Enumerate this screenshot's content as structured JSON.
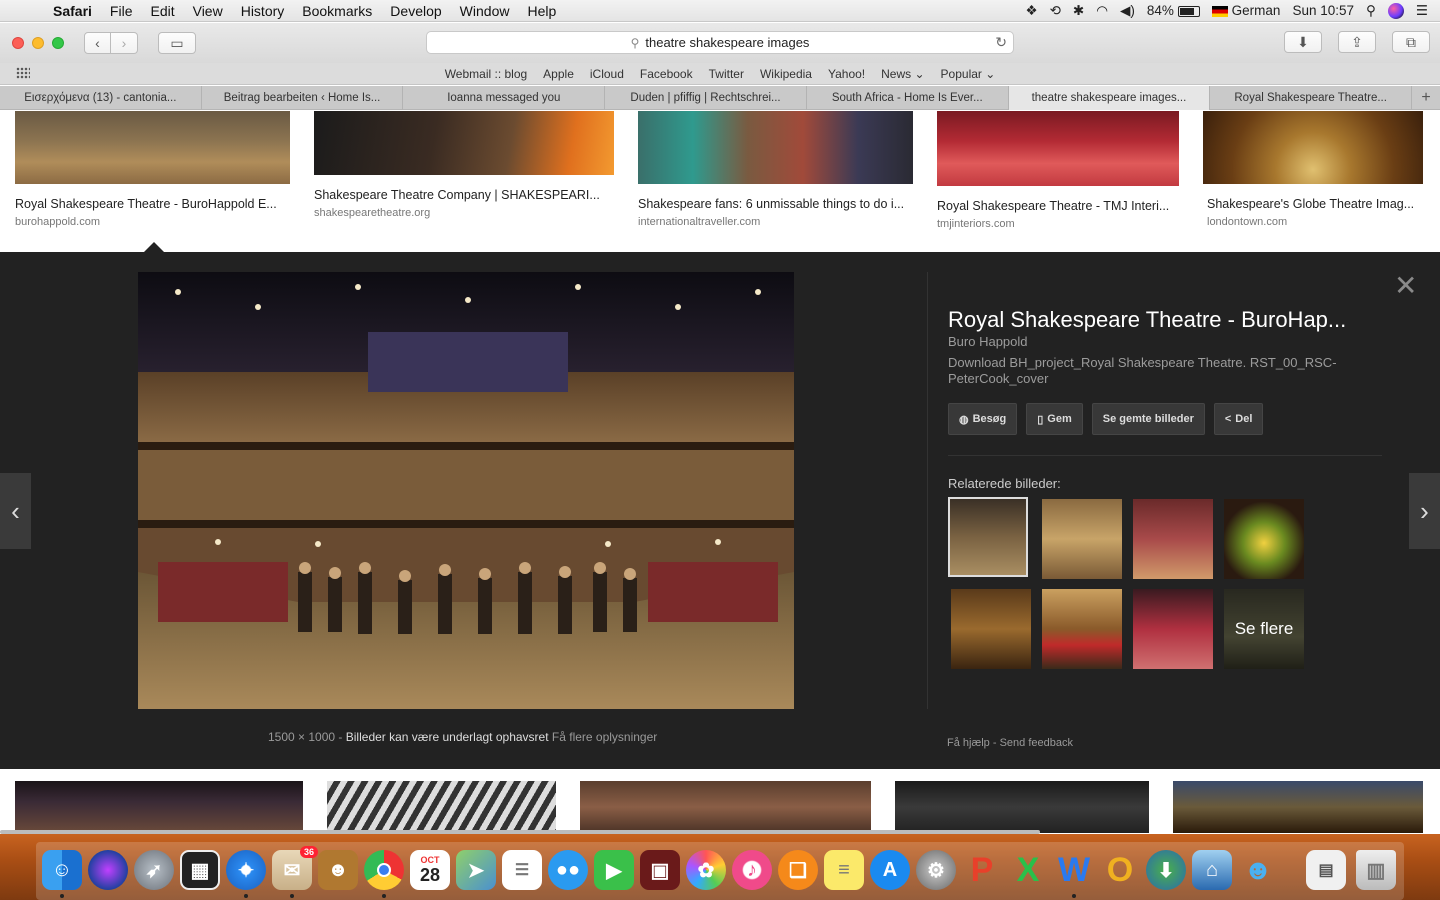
{
  "menubar": {
    "apple": "",
    "items": [
      "Safari",
      "File",
      "Edit",
      "View",
      "History",
      "Bookmarks",
      "Develop",
      "Window",
      "Help"
    ],
    "battery": "84%",
    "input_source": "German",
    "clock": "Sun 10:57"
  },
  "toolbar": {
    "url": "theatre shakespeare images"
  },
  "favorites": [
    "Webmail :: blog",
    "Apple",
    "iCloud",
    "Facebook",
    "Twitter",
    "Wikipedia",
    "Yahoo!",
    "News ⌄",
    "Popular ⌄"
  ],
  "tabs": [
    {
      "label": "Εισερχόμενα (13) - cantonia...",
      "active": false
    },
    {
      "label": "Beitrag bearbeiten ‹ Home Is...",
      "active": false
    },
    {
      "label": "Ioanna messaged you",
      "active": false
    },
    {
      "label": "Duden | pfiffig | Rechtschrei...",
      "active": false
    },
    {
      "label": "South Africa - Home Is Ever...",
      "active": false
    },
    {
      "label": "theatre shakespeare images...",
      "active": true
    },
    {
      "label": "Royal Shakespeare Theatre...",
      "active": false
    }
  ],
  "results_top": [
    {
      "title": "Royal Shakespeare Theatre - BuroHappold E...",
      "source": "burohappold.com"
    },
    {
      "title": "Shakespeare Theatre Company | SHAKESPEARI...",
      "source": "shakespearetheatre.org"
    },
    {
      "title": "Shakespeare fans: 6 unmissable things to do i...",
      "source": "internationaltraveller.com"
    },
    {
      "title": "Royal Shakespeare Theatre - TMJ Interi...",
      "source": "tmjinteriors.com"
    },
    {
      "title": "Shakespeare's Globe Theatre Imag...",
      "source": "londontown.com"
    }
  ],
  "preview": {
    "dimensions": "1500 × 1000",
    "separator": "-",
    "copyright": "Billeder kan være underlagt ophavsret",
    "more_info": "Få flere oplysninger",
    "title": "Royal Shakespeare Theatre - BuroHap...",
    "source": "Buro Happold",
    "description": "Download BH_project_Royal Shakespeare Theatre. RST_00_RSC-PeterCook_cover",
    "actions": [
      {
        "label": "Besøg",
        "icon": "globe-icon"
      },
      {
        "label": "Gem",
        "icon": "bookmark-icon"
      },
      {
        "label": "Se gemte billeder",
        "icon": ""
      },
      {
        "label": "Del",
        "icon": "share-icon"
      }
    ],
    "related_label": "Relaterede billeder:",
    "see_more": "Se flere",
    "help": "Få hjælp",
    "help_sep": "-",
    "feedback": "Send feedback"
  },
  "dock": {
    "mail_badge": "36",
    "calendar_month": "OCT",
    "calendar_day": "28"
  },
  "colors": {
    "panel_bg": "#222222",
    "dock_bg": "#a94e14",
    "active_tab": "#e6e6e6"
  }
}
